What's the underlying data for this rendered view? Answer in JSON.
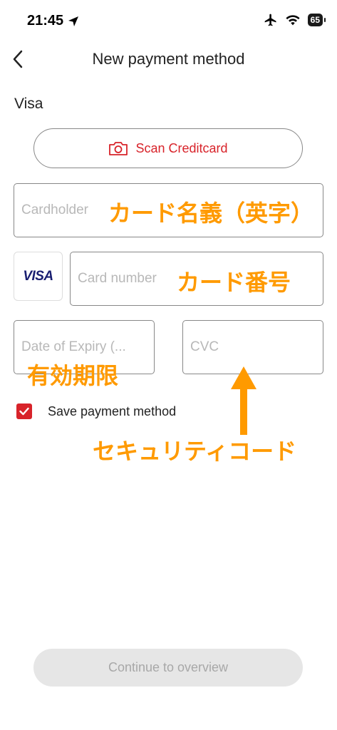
{
  "status_bar": {
    "time": "21:45",
    "battery": "65"
  },
  "header": {
    "title": "New payment method"
  },
  "card_brand": "Visa",
  "scan_button": {
    "label": "Scan Creditcard"
  },
  "form": {
    "cardholder_placeholder": "Cardholder",
    "card_number_placeholder": "Card number",
    "expiry_placeholder": "Date of Expiry (...",
    "cvc_placeholder": "CVC",
    "visa_logo": "VISA"
  },
  "save_payment": {
    "label": "Save payment method",
    "checked": true
  },
  "annotations": {
    "cardholder": "カード名義（英字）",
    "card_number": "カード番号",
    "expiry": "有効期限",
    "cvc": "セキュリティコード"
  },
  "continue_button": {
    "label": "Continue to overview",
    "enabled": false
  },
  "colors": {
    "accent": "#d8232a",
    "annotation": "#ff9a00",
    "visa": "#1a1f71",
    "disabled_bg": "#e6e6e6"
  },
  "icons": [
    "location-arrow-icon",
    "airplane-icon",
    "wifi-icon",
    "battery-icon",
    "back-chevron-icon",
    "camera-icon",
    "checkmark-icon",
    "up-arrow-icon"
  ]
}
